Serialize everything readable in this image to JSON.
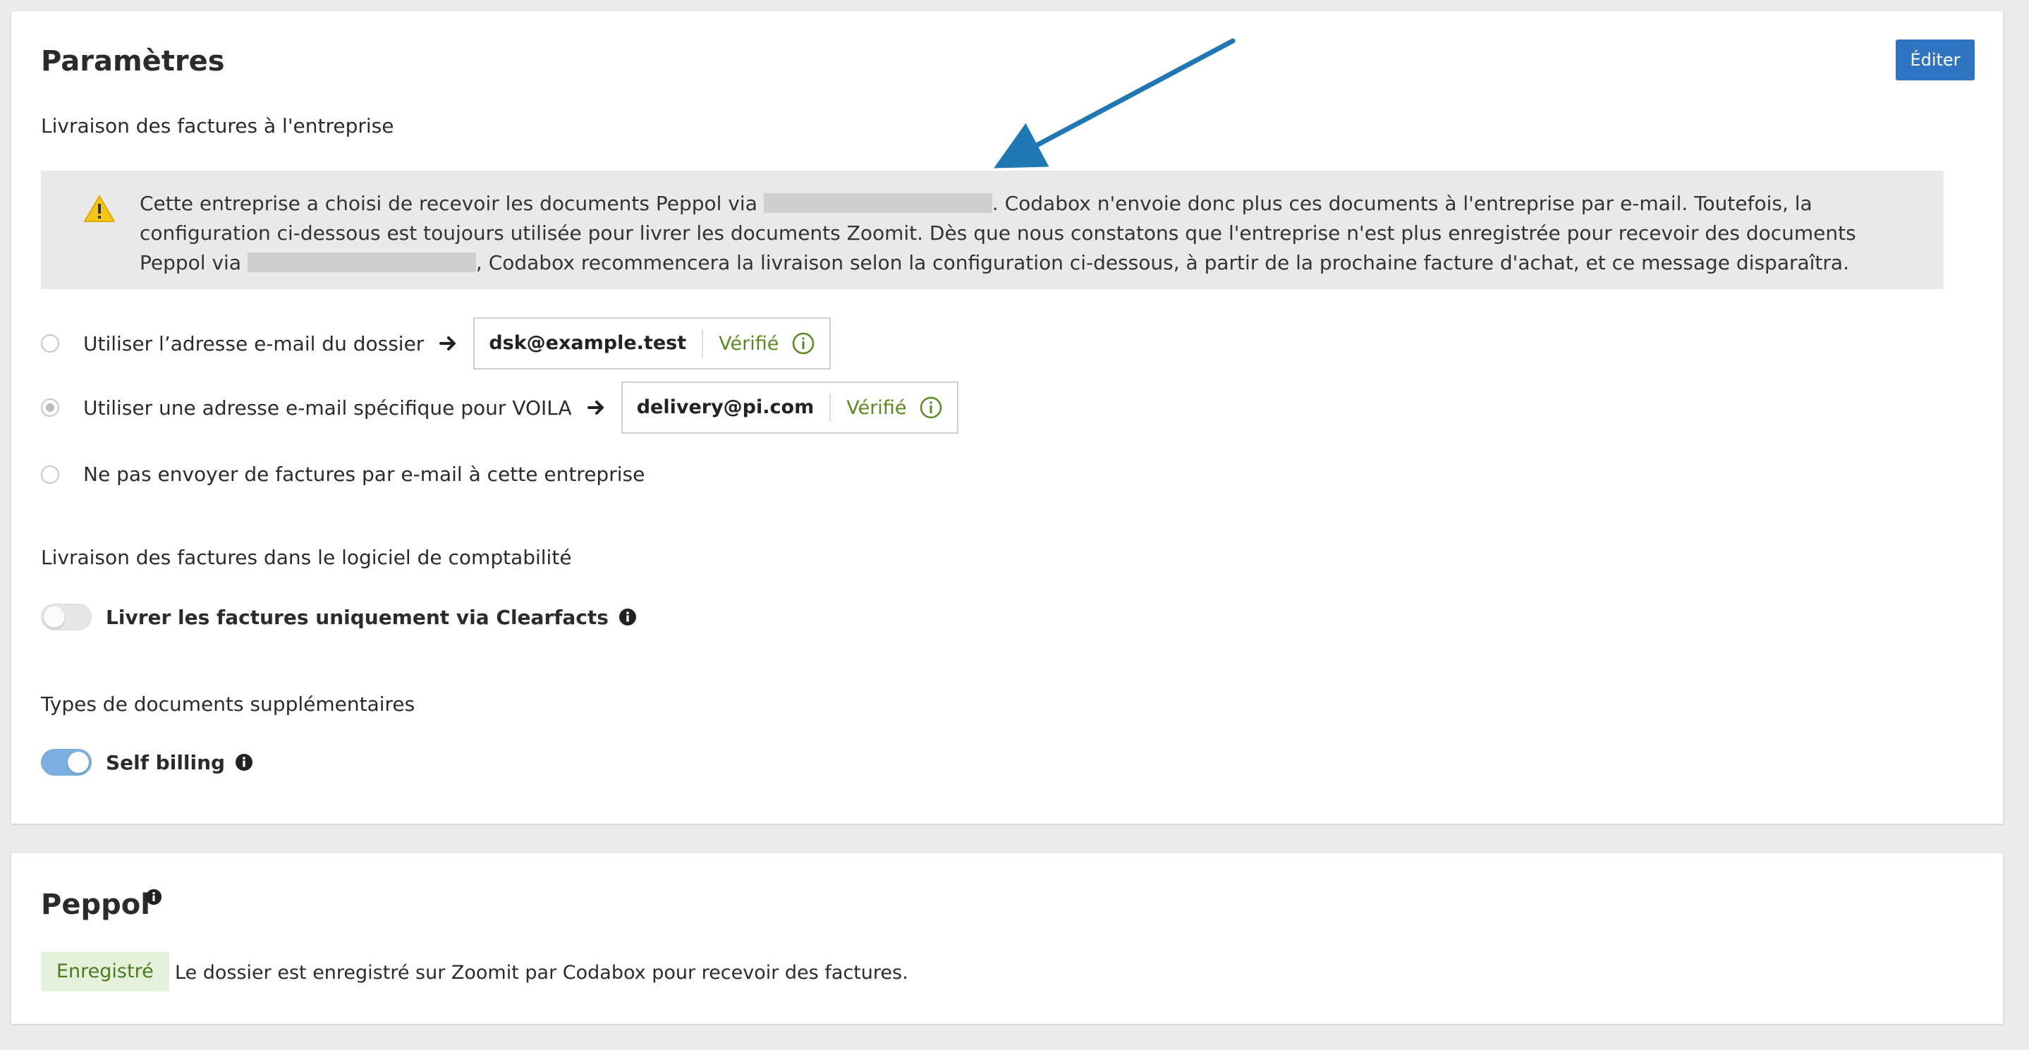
{
  "params": {
    "title": "Paramètres",
    "edit_label": "Éditer",
    "delivery_company_label": "Livraison des factures à l'entreprise",
    "warning": {
      "text_1": "Cette entreprise a choisi de recevoir les documents Peppol via",
      "text_2": ". Codabox n'envoie donc plus ces documents à l'entreprise par e-mail. Toutefois, la configuration ci-dessous est toujours utilisée pour livrer les documents Zoomit. Dès que nous constatons que l'entreprise n'est plus enregistrée pour recevoir des documents Peppol via",
      "text_3": ", Codabox recommencera la livraison selon la configuration ci-dessous, à partir de la prochaine facture d'achat, et ce message disparaîtra."
    },
    "options": [
      {
        "label": "Utiliser l’adresse e-mail du dossier",
        "email": "dsk@example.test",
        "status": "Vérifié",
        "selected": false
      },
      {
        "label": "Utiliser une adresse e-mail spécifique pour VOILA",
        "email": "delivery@pi.com",
        "status": "Vérifié",
        "selected": true
      },
      {
        "label": "Ne pas envoyer de factures par e-mail à cette entreprise",
        "selected": false
      }
    ],
    "accounting_label": "Livraison des factures dans le logiciel de comptabilité",
    "clearfacts_toggle": {
      "label": "Livrer les factures uniquement via Clearfacts",
      "on": false
    },
    "extra_types_label": "Types de documents supplémentaires",
    "self_billing_toggle": {
      "label": "Self billing",
      "on": true
    }
  },
  "peppol": {
    "title": "Peppol",
    "badge": "Enregistré",
    "description": "Le dossier est enregistré sur Zoomit par Codabox pour recevoir des factures."
  },
  "colors": {
    "primary": "#2f74c0",
    "success_text": "#5a8a1e",
    "badge_bg": "#e4f1d8",
    "warning": "#f5c518",
    "annotation_arrow": "#1f78b4"
  }
}
